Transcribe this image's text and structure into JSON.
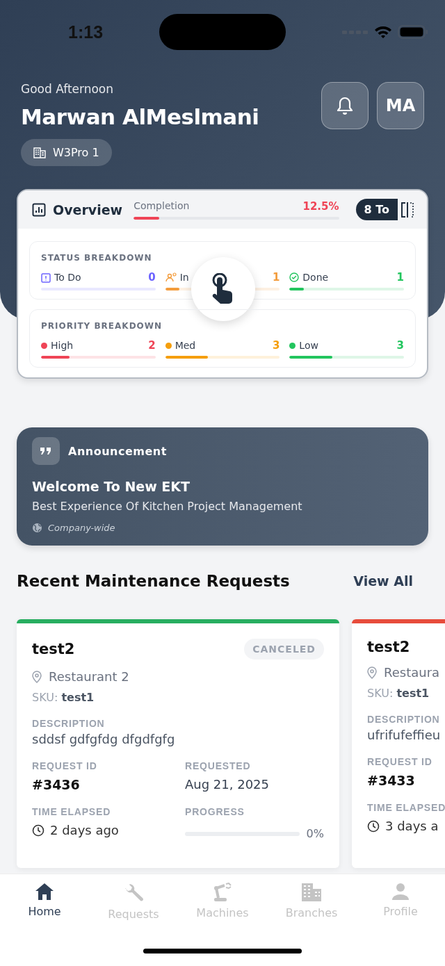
{
  "status_bar": {
    "time": "1:13"
  },
  "header": {
    "greeting": "Good Afternoon",
    "name": "Marwan AlMeslmani",
    "avatar_initials": "MA",
    "branch": "W3Pro 1"
  },
  "overview": {
    "title": "Overview",
    "completion_label": "Completion",
    "completion": "12.5%",
    "level": 0.125,
    "total": "8 To",
    "status_title": "STATUS BREAKDOWN",
    "status": [
      {
        "kind": "todo",
        "label": "To Do",
        "count": "0",
        "level": 0,
        "color": "#6c63ff"
      },
      {
        "kind": "progress",
        "label": "In",
        "count": "1",
        "level": 0.125,
        "color": "#f39c3c"
      },
      {
        "kind": "done",
        "label": "Done",
        "count": "1",
        "level": 0.125,
        "color": "#22c55e"
      }
    ],
    "priority_title": "PRIORITY BREAKDOWN",
    "priority": [
      {
        "label": "High",
        "count": "2",
        "level": 0.25,
        "color": "#ef4456"
      },
      {
        "label": "Med",
        "count": "3",
        "level": 0.375,
        "color": "#f59e0b"
      },
      {
        "label": "Low",
        "count": "3",
        "level": 0.375,
        "color": "#22c55e"
      }
    ]
  },
  "announcement": {
    "label": "Announcement",
    "title": "Welcome To New EKT",
    "body": "Best Experience Of Kitchen Project Management",
    "scope": "Company-wide"
  },
  "recent": {
    "title": "Recent Maintenance Requests",
    "view_all": "View All",
    "requests": [
      {
        "color": "#27ae60",
        "name": "test2",
        "status": "CANCELED",
        "location": "Restaurant 2",
        "sku_label": "SKU:",
        "sku": "test1",
        "description_label": "DESCRIPTION",
        "description": "sddsf gdfgfdg dfgdfgfg",
        "id_label": "REQUEST ID",
        "id": "#3436",
        "requested_label": "REQUESTED",
        "requested": "Aug 21, 2025",
        "elapsed_label": "TIME ELAPSED",
        "elapsed": "2 days ago",
        "progress_label": "PROGRESS",
        "level": 0,
        "progress": "0%"
      },
      {
        "color": "#e74c3c",
        "name": "test2",
        "location": "Restaura",
        "sku_label": "SKU:",
        "sku": "test1",
        "description_label": "DESCRIPTION",
        "description": "ufrifufeffieu",
        "id_label": "REQUEST ID",
        "id": "#3433",
        "elapsed_label": "TIME ELAPSED",
        "elapsed": "3 days a"
      }
    ]
  },
  "nav": [
    {
      "kind": "home",
      "label": "Home",
      "selected": true
    },
    {
      "kind": "requests",
      "label": "Requests",
      "selected": false
    },
    {
      "kind": "machines",
      "label": "Machines",
      "selected": false
    },
    {
      "kind": "branches",
      "label": "Branches",
      "selected": false
    },
    {
      "kind": "profile",
      "label": "Profile",
      "selected": false
    }
  ]
}
